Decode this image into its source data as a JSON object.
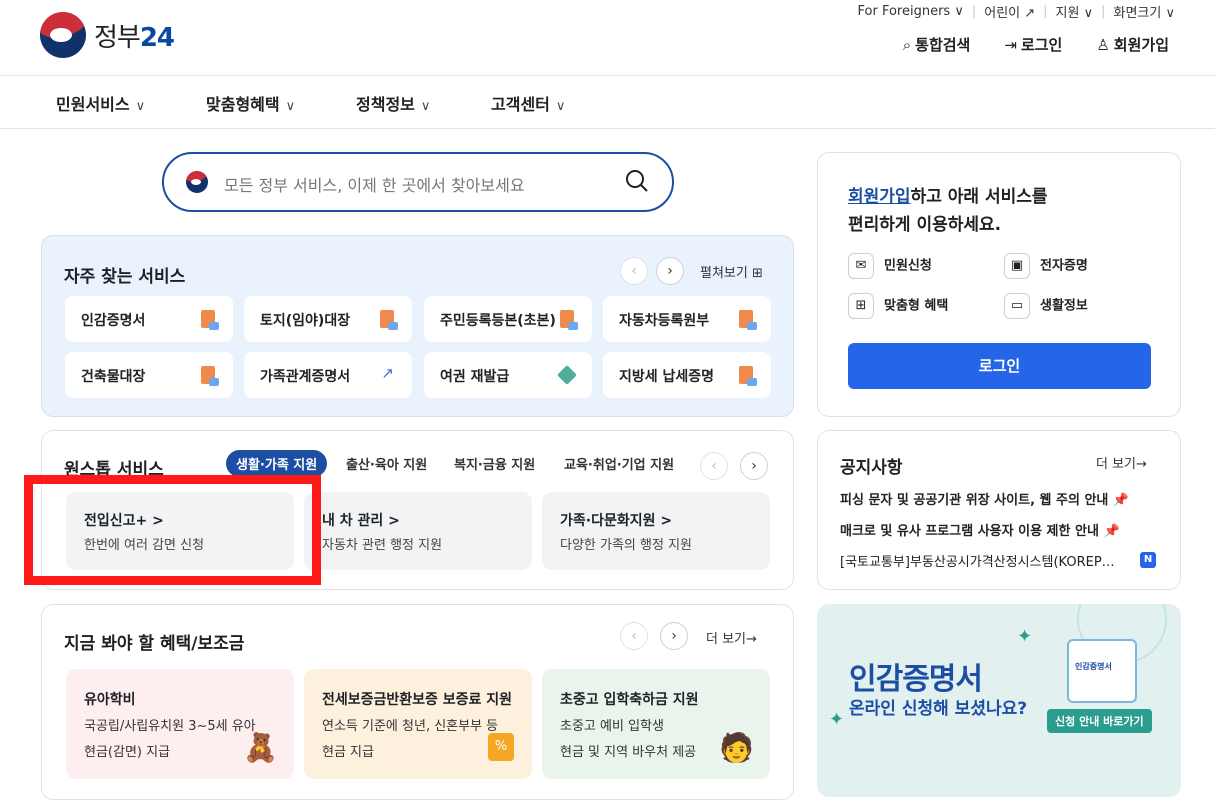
{
  "brand": {
    "logo_text": "정부",
    "logo_num": "24"
  },
  "util": {
    "foreigners": "For Foreigners ∨",
    "kids": "어린이 ↗",
    "support": "지원 ∨",
    "fontsize": "화면크기 ∨"
  },
  "actions": {
    "search": "통합검색",
    "login": "로그인",
    "signup": "회원가입"
  },
  "nav": [
    "민원서비스",
    "맞춤형혜택",
    "정책정보",
    "고객센터"
  ],
  "search": {
    "placeholder": "모든 정부 서비스, 이제 한 곳에서 찾아보세요"
  },
  "favorites": {
    "title": "자주 찾는 서비스",
    "expand": "펼쳐보기",
    "items": [
      {
        "label": "인감증명서",
        "icon": "document-icon"
      },
      {
        "label": "토지(임야)대장",
        "icon": "document-icon"
      },
      {
        "label": "주민등록등본(초본)",
        "icon": "document-icon"
      },
      {
        "label": "자동차등록원부",
        "icon": "document-icon"
      },
      {
        "label": "건축물대장",
        "icon": "document-icon"
      },
      {
        "label": "가족관계증명서",
        "icon": "external-link-icon"
      },
      {
        "label": "여권 재발급",
        "icon": "pen-icon"
      },
      {
        "label": "지방세 납세증명",
        "icon": "document-icon"
      }
    ]
  },
  "onestop": {
    "title": "원스톱 서비스",
    "tabs": [
      "생활·가족 지원",
      "출산·육아 지원",
      "복지·금융 지원",
      "교육·취업·기업 지원"
    ],
    "tiles": [
      {
        "title": "전입신고+ >",
        "sub": "한번에 여러 감면 신청"
      },
      {
        "title": "내 차 관리 >",
        "sub": "자동차 관련 행정 지원"
      },
      {
        "title": "가족·다문화지원 >",
        "sub": "다양한 가족의 행정 지원"
      }
    ]
  },
  "benefit": {
    "title": "지금 봐야 할 혜택/보조금",
    "more": "더 보기→",
    "tiles": [
      {
        "title": "유아학비",
        "l1": "국공립/사립유치원 3~5세 유아",
        "l2": "현금(감면) 지급",
        "color": "#fdeef0"
      },
      {
        "title": "전세보증금반환보증 보증료 지원",
        "l1": "연소득 기준에 청년, 신혼부부 등",
        "l2": "현금 지급",
        "color": "#fdf1de"
      },
      {
        "title": "초중고 입학축하금 지원",
        "l1": "초중고 예비 입학생",
        "l2": "현금 및 지역 바우처 제공",
        "color": "#e8f4ec"
      }
    ]
  },
  "login_card": {
    "hl": "회원가입",
    "msg1": "하고 아래 서비스를",
    "msg2": "편리하게 이용하세요.",
    "features": [
      "민원신청",
      "전자증명",
      "맞춤형 혜택",
      "생활정보"
    ],
    "button": "로그인"
  },
  "notice": {
    "title": "공지사항",
    "more": "더 보기→",
    "items": [
      "피싱 문자 및 공공기관 위장 사이트, 웹 주의 안내 📌",
      "매크로 및 유사 프로그램 사용자 이용 제한 안내 📌",
      "[국토교통부]부동산공시가격산정시스템(KOREP…"
    ],
    "new_badge": "N"
  },
  "banner": {
    "line1": "인감증명서",
    "line2": "온라인 신청해 보셨나요?",
    "cta": "신청 안내 바로가기",
    "doc_label": "인감증명서"
  }
}
